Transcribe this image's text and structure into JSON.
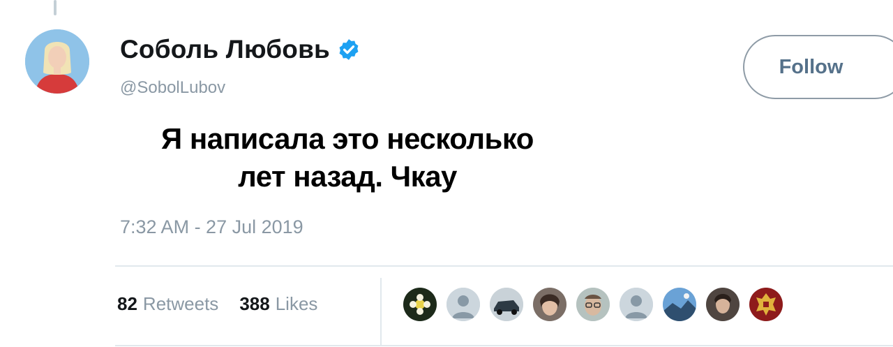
{
  "tweet": {
    "display_name": "Соболь Любовь",
    "handle": "@SobolLubov",
    "follow_label": "Follow",
    "text_line1": "Я написала это несколько",
    "text_line2": "лет назад. Чкау",
    "timestamp": "7:32 AM - 27 Jul 2019",
    "retweets_count": "82",
    "retweets_label": "Retweets",
    "likes_count": "388",
    "likes_label": "Likes"
  },
  "colors": {
    "verified": "#1da1f2",
    "follow_border": "#8e9ba6",
    "secondary_text": "#8a98a4"
  },
  "likers": [
    {
      "icon": "liker-avatar-dark-flower"
    },
    {
      "icon": "liker-avatar-default"
    },
    {
      "icon": "liker-avatar-car"
    },
    {
      "icon": "liker-avatar-woman"
    },
    {
      "icon": "liker-avatar-man-glasses"
    },
    {
      "icon": "liker-avatar-default"
    },
    {
      "icon": "liker-avatar-landscape"
    },
    {
      "icon": "liker-avatar-portrait"
    },
    {
      "icon": "liker-avatar-emblem"
    }
  ]
}
